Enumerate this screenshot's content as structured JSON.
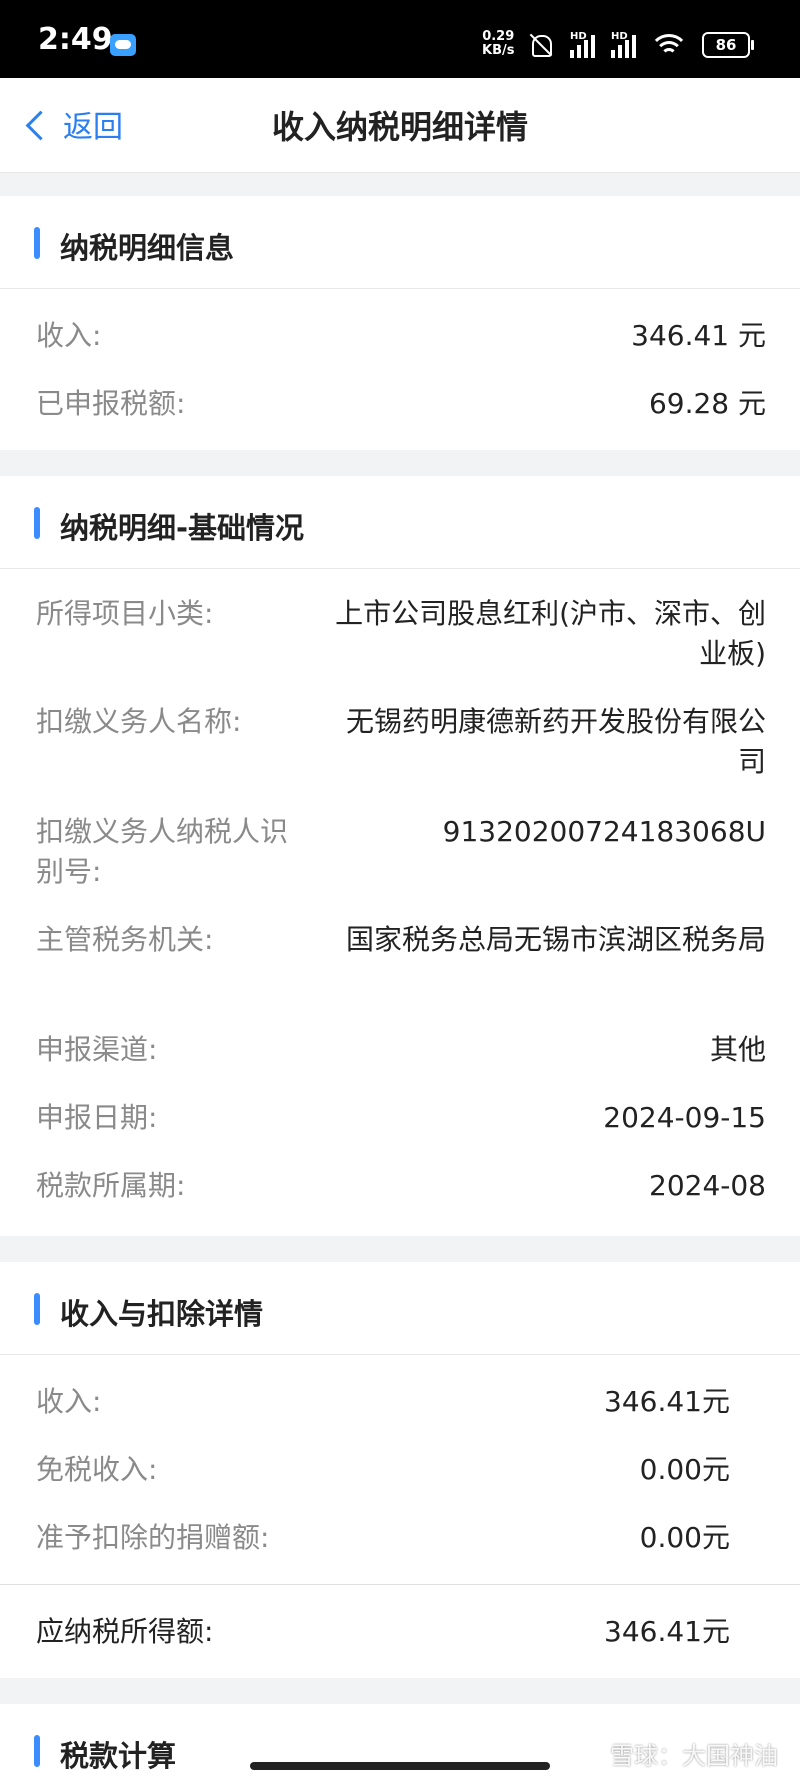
{
  "status_bar": {
    "time": "2:49",
    "net_speed_value": "0.29",
    "net_speed_unit": "KB/s",
    "signal_label_1": "HD",
    "signal_label_2": "HD",
    "battery": "86",
    "icons": [
      "cloud-app-icon",
      "mute-bell-icon",
      "signal-icon",
      "wifi-icon",
      "battery-icon"
    ]
  },
  "nav": {
    "back_label": "返回",
    "title": "收入纳税明细详情"
  },
  "section_tax_info": {
    "title": "纳税明细信息",
    "rows": [
      {
        "label": "收入:",
        "value": "346.41 元"
      },
      {
        "label": "已申报税额:",
        "value": "69.28 元"
      }
    ]
  },
  "section_basic": {
    "title": "纳税明细-基础情况",
    "rows": [
      {
        "label": "所得项目小类:",
        "value": "上市公司股息红利(沪市、深市、创业板)"
      },
      {
        "label": "扣缴义务人名称:",
        "value": "无锡药明康德新药开发股份有限公司"
      },
      {
        "label": "扣缴义务人纳税人识别号:",
        "value": "91320200724183068U"
      },
      {
        "label": "主管税务机关:",
        "value": "国家税务总局无锡市滨湖区税务局"
      },
      {
        "label": "申报渠道:",
        "value": "其他"
      },
      {
        "label": "申报日期:",
        "value": "2024-09-15"
      },
      {
        "label": "税款所属期:",
        "value": "2024-08"
      }
    ]
  },
  "section_income": {
    "title": "收入与扣除详情",
    "rows": [
      {
        "label": "收入:",
        "value": "346.41元"
      },
      {
        "label": "免税收入:",
        "value": "0.00元"
      },
      {
        "label": "准予扣除的捐赠额:",
        "value": "0.00元"
      }
    ],
    "taxable": {
      "label": "应纳税所得额:",
      "value": "346.41元"
    }
  },
  "section_calc": {
    "title": "税款计算"
  },
  "watermark": "雪球：大国神油",
  "colors": {
    "accent": "#2b7ff0",
    "section_bar": "#3b8cff",
    "background": "#f2f3f5"
  }
}
